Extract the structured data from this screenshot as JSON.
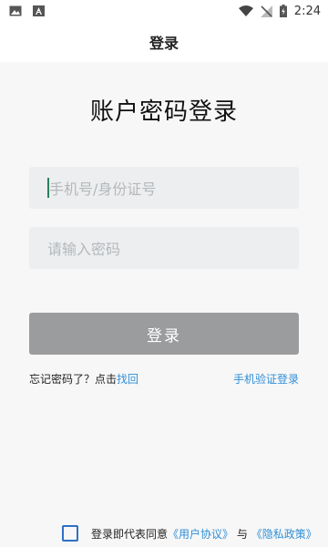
{
  "status_bar": {
    "time": "2:24",
    "left_icons": [
      "image-icon",
      "text-icon"
    ],
    "right_icons": [
      "wifi-icon",
      "no-signal-icon",
      "battery-icon"
    ]
  },
  "app_bar": {
    "title": "登录"
  },
  "main": {
    "heading": "账户密码登录",
    "phone_placeholder": "手机号/身份证号",
    "password_placeholder": "请输入密码",
    "login_button": "登录",
    "forgot_text": "忘记密码了？点击",
    "forgot_link": "找回",
    "sms_login_link": "手机验证登录"
  },
  "agreement": {
    "prefix": "登录即代表同意",
    "user_agreement": "《用户协议》",
    "and": "与",
    "privacy_policy": "《隐私政策》",
    "checked": false
  },
  "colors": {
    "link": "#2f8fd8",
    "button_bg": "#9a9c9e",
    "field_bg": "#eceeef",
    "page_bg": "#f7f7f7",
    "checkbox_border": "#2f6fc8"
  }
}
